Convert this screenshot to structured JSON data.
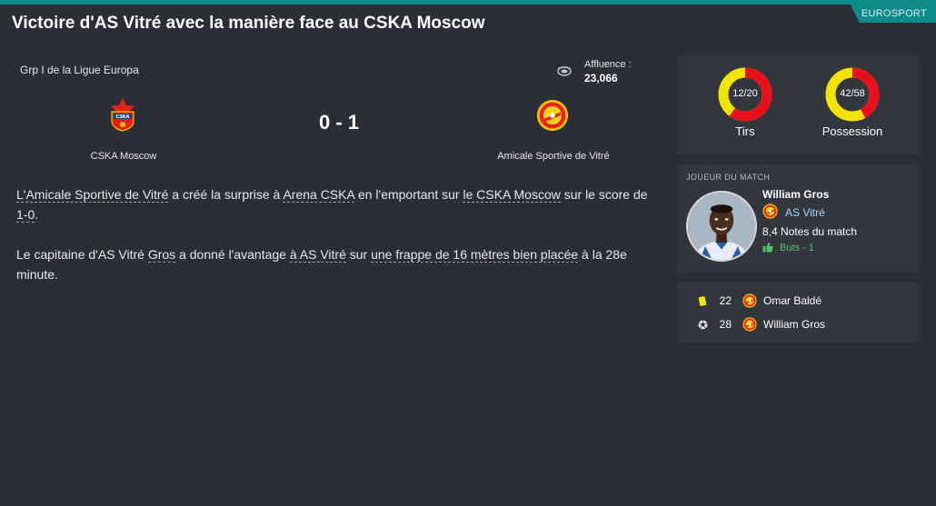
{
  "source": "EUROSPORT",
  "headline": "Victoire d'AS Vitré avec la manière face au CSKA Moscow",
  "match": {
    "competition": "Grp I de la Ligue Europa",
    "attendance_label": "Affluence :",
    "attendance_value": "23,066",
    "score": "0 - 1",
    "home_team": "CSKA Moscow",
    "away_team": "Amicale Sportive de Vitré"
  },
  "report": {
    "p1": {
      "a1": "L'Amicale Sportive de Vitré",
      "t1": " a créé la surprise à ",
      "a2": "Arena CSKA",
      "t2": " en l'emportant sur ",
      "a3": "le CSKA Moscow",
      "t3": " sur le score de ",
      "a4": "1-0",
      "t4": "."
    },
    "p2": {
      "t1": "Le capitaine d'AS Vitré ",
      "a1": "Gros",
      "t2": " a donné l'avantage ",
      "a2": "à AS Vitré",
      "t3": " sur ",
      "a3": "une frappe de 16 mètres bien placée",
      "t4": " à la 28e minute."
    }
  },
  "stats": {
    "shots_value": "12/20",
    "shots_label": "Tirs",
    "shots_fraction": 0.6,
    "possession_value": "42/58",
    "possession_label": "Possession",
    "possession_fraction": 0.42,
    "color_home": "#e8101a",
    "color_away": "#f2e400"
  },
  "motm": {
    "header": "JOUEUR DU MATCH",
    "name": "William Gros",
    "club": "AS Vitré",
    "rating": "8,4 Notes du match",
    "goals": "Buts - 1"
  },
  "events": [
    {
      "icon": "yellow-card-icon",
      "minute": "22",
      "player": "Omar Baldé"
    },
    {
      "icon": "ball-icon",
      "minute": "28",
      "player": "William Gros"
    }
  ],
  "colors": {
    "background": "#2b2e35",
    "panel": "#33363d",
    "accent": "#0f8a8a",
    "link": "#a8d4ff",
    "goal": "#4fc36b"
  }
}
